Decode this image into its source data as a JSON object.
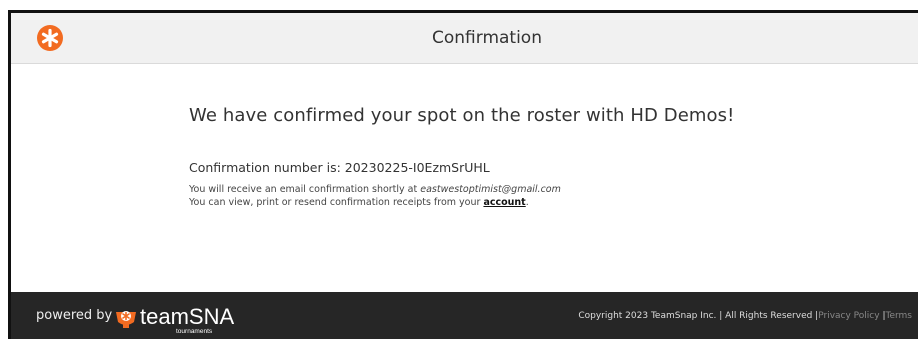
{
  "header": {
    "title": "Confirmation",
    "logo_icon": "orange-asterisk-badge-icon"
  },
  "main": {
    "headline": "We have confirmed your spot on the roster with HD Demos!",
    "confirmation_label": "Confirmation number is: 20230225-I0EzmSrUHL",
    "email_prefix": "You will receive an email confirmation shortly at ",
    "email": "eastwestoptimist@gmail.com",
    "receipts_prefix": "You can view, print or resend confirmation receipts from your ",
    "account_link": "account",
    "receipts_suffix": "."
  },
  "footer": {
    "powered_by": "powered by",
    "brand_name": "teamSNAP",
    "brand_sub": "tournaments",
    "copyright": "Copyright 2023 TeamSnap Inc. | All Rights Reserved |",
    "privacy_link": "Privacy Policy",
    "separator": "|",
    "terms_link": "Terms"
  },
  "colors": {
    "brand_orange": "#f26b21",
    "footer_bg": "#262626",
    "header_bg": "#f1f1f1"
  }
}
